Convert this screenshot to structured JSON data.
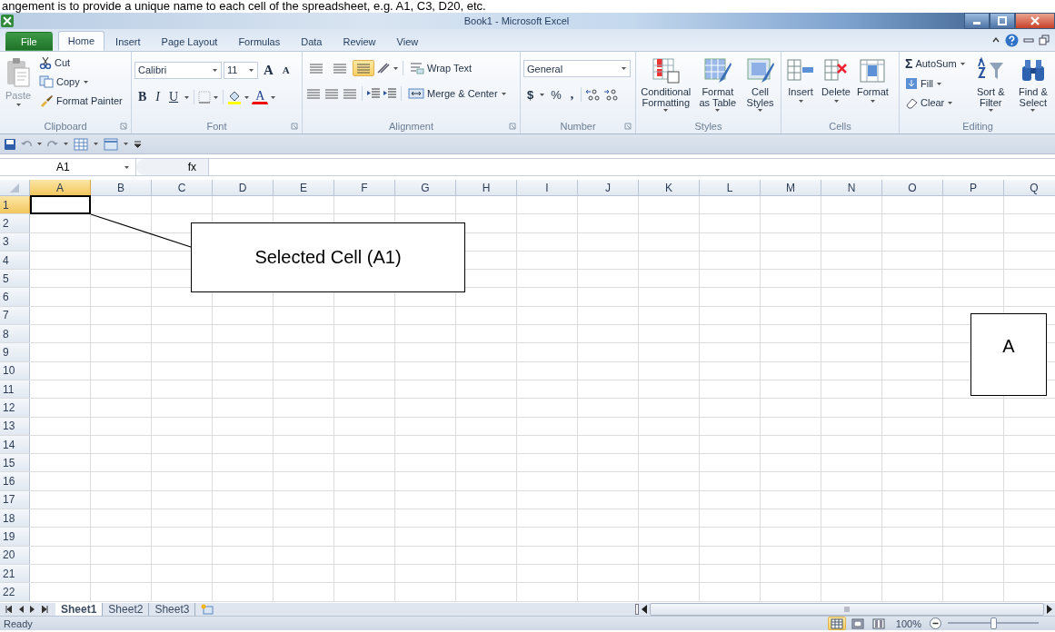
{
  "caption": "angement is to provide a unique name to each cell of the spreadsheet, e.g. A1, C3, D20, etc.",
  "window": {
    "title": "Book1 - Microsoft Excel"
  },
  "ribbon_tabs": [
    {
      "label": "File",
      "kind": "file",
      "selected": false
    },
    {
      "label": "Home",
      "kind": "tab",
      "selected": true
    },
    {
      "label": "Insert",
      "kind": "tab",
      "selected": false
    },
    {
      "label": "Page Layout",
      "kind": "tab",
      "selected": false
    },
    {
      "label": "Formulas",
      "kind": "tab",
      "selected": false
    },
    {
      "label": "Data",
      "kind": "tab",
      "selected": false
    },
    {
      "label": "Review",
      "kind": "tab",
      "selected": false
    },
    {
      "label": "View",
      "kind": "tab",
      "selected": false
    }
  ],
  "ribbon": {
    "clipboard": {
      "label": "Clipboard",
      "paste": "Paste",
      "cut": "Cut",
      "copy": "Copy",
      "format_painter": "Format Painter"
    },
    "font": {
      "label": "Font",
      "font_name": "Calibri",
      "font_size": "11",
      "grow": "A",
      "shrink": "A",
      "bold": "B",
      "italic": "I",
      "underline": "U",
      "font_color": "A"
    },
    "alignment": {
      "label": "Alignment",
      "vertical": [
        {
          "selected": false
        },
        {
          "selected": false
        },
        {
          "selected": true
        }
      ],
      "wrap_text": "Wrap Text",
      "merge": "Merge & Center"
    },
    "number": {
      "label": "Number",
      "format": "General",
      "currency": "$",
      "percent": "%",
      "comma": ","
    },
    "styles": {
      "label": "Styles",
      "buttons": [
        {
          "lines": [
            "Conditional",
            "Formatting"
          ]
        },
        {
          "lines": [
            "Format",
            "as Table"
          ]
        },
        {
          "lines": [
            "Cell",
            "Styles"
          ]
        }
      ]
    },
    "cells": {
      "label": "Cells",
      "buttons": [
        {
          "lines": [
            "Insert"
          ]
        },
        {
          "lines": [
            "Delete"
          ]
        },
        {
          "lines": [
            "Format"
          ]
        }
      ]
    },
    "editing": {
      "label": "Editing",
      "sigma": "Σ",
      "autosum": "AutoSum",
      "fill": "Fill",
      "clear": "Clear",
      "buttons": [
        {
          "lines": [
            "Sort &",
            "Filter"
          ]
        },
        {
          "lines": [
            "Find &",
            "Select"
          ]
        }
      ]
    }
  },
  "formula_bar": {
    "name_box": "A1",
    "fx": "fx"
  },
  "columns": [
    {
      "label": "A",
      "selected": true
    },
    {
      "label": "B",
      "selected": false
    },
    {
      "label": "C",
      "selected": false
    },
    {
      "label": "D",
      "selected": false
    },
    {
      "label": "E",
      "selected": false
    },
    {
      "label": "F",
      "selected": false
    },
    {
      "label": "G",
      "selected": false
    },
    {
      "label": "H",
      "selected": false
    },
    {
      "label": "I",
      "selected": false
    },
    {
      "label": "J",
      "selected": false
    },
    {
      "label": "K",
      "selected": false
    },
    {
      "label": "L",
      "selected": false
    },
    {
      "label": "M",
      "selected": false
    },
    {
      "label": "N",
      "selected": false
    },
    {
      "label": "O",
      "selected": false
    },
    {
      "label": "P",
      "selected": false
    },
    {
      "label": "Q",
      "selected": false
    }
  ],
  "rows": [
    {
      "label": "1",
      "selected": true
    },
    {
      "label": "2",
      "selected": false
    },
    {
      "label": "3",
      "selected": false
    },
    {
      "label": "4",
      "selected": false
    },
    {
      "label": "5",
      "selected": false
    },
    {
      "label": "6",
      "selected": false
    },
    {
      "label": "7",
      "selected": false
    },
    {
      "label": "8",
      "selected": false
    },
    {
      "label": "9",
      "selected": false
    },
    {
      "label": "10",
      "selected": false
    },
    {
      "label": "11",
      "selected": false
    },
    {
      "label": "12",
      "selected": false
    },
    {
      "label": "13",
      "selected": false
    },
    {
      "label": "14",
      "selected": false
    },
    {
      "label": "15",
      "selected": false
    },
    {
      "label": "16",
      "selected": false
    },
    {
      "label": "17",
      "selected": false
    },
    {
      "label": "18",
      "selected": false
    },
    {
      "label": "19",
      "selected": false
    },
    {
      "label": "20",
      "selected": false
    },
    {
      "label": "21",
      "selected": false
    },
    {
      "label": "22",
      "selected": false
    }
  ],
  "callouts": [
    {
      "kind": "leader",
      "text": "Selected Cell (A1)"
    },
    {
      "kind": "box",
      "text": "A"
    }
  ],
  "sheet_tabs": [
    {
      "label": "Sheet1",
      "selected": true
    },
    {
      "label": "Sheet2",
      "selected": false
    },
    {
      "label": "Sheet3",
      "selected": false
    }
  ],
  "status_bar": {
    "status": "Ready",
    "views": [
      {
        "selected": true
      },
      {
        "selected": false
      },
      {
        "selected": false
      }
    ],
    "zoom": {
      "reading": "100%",
      "level": 0.5
    }
  }
}
